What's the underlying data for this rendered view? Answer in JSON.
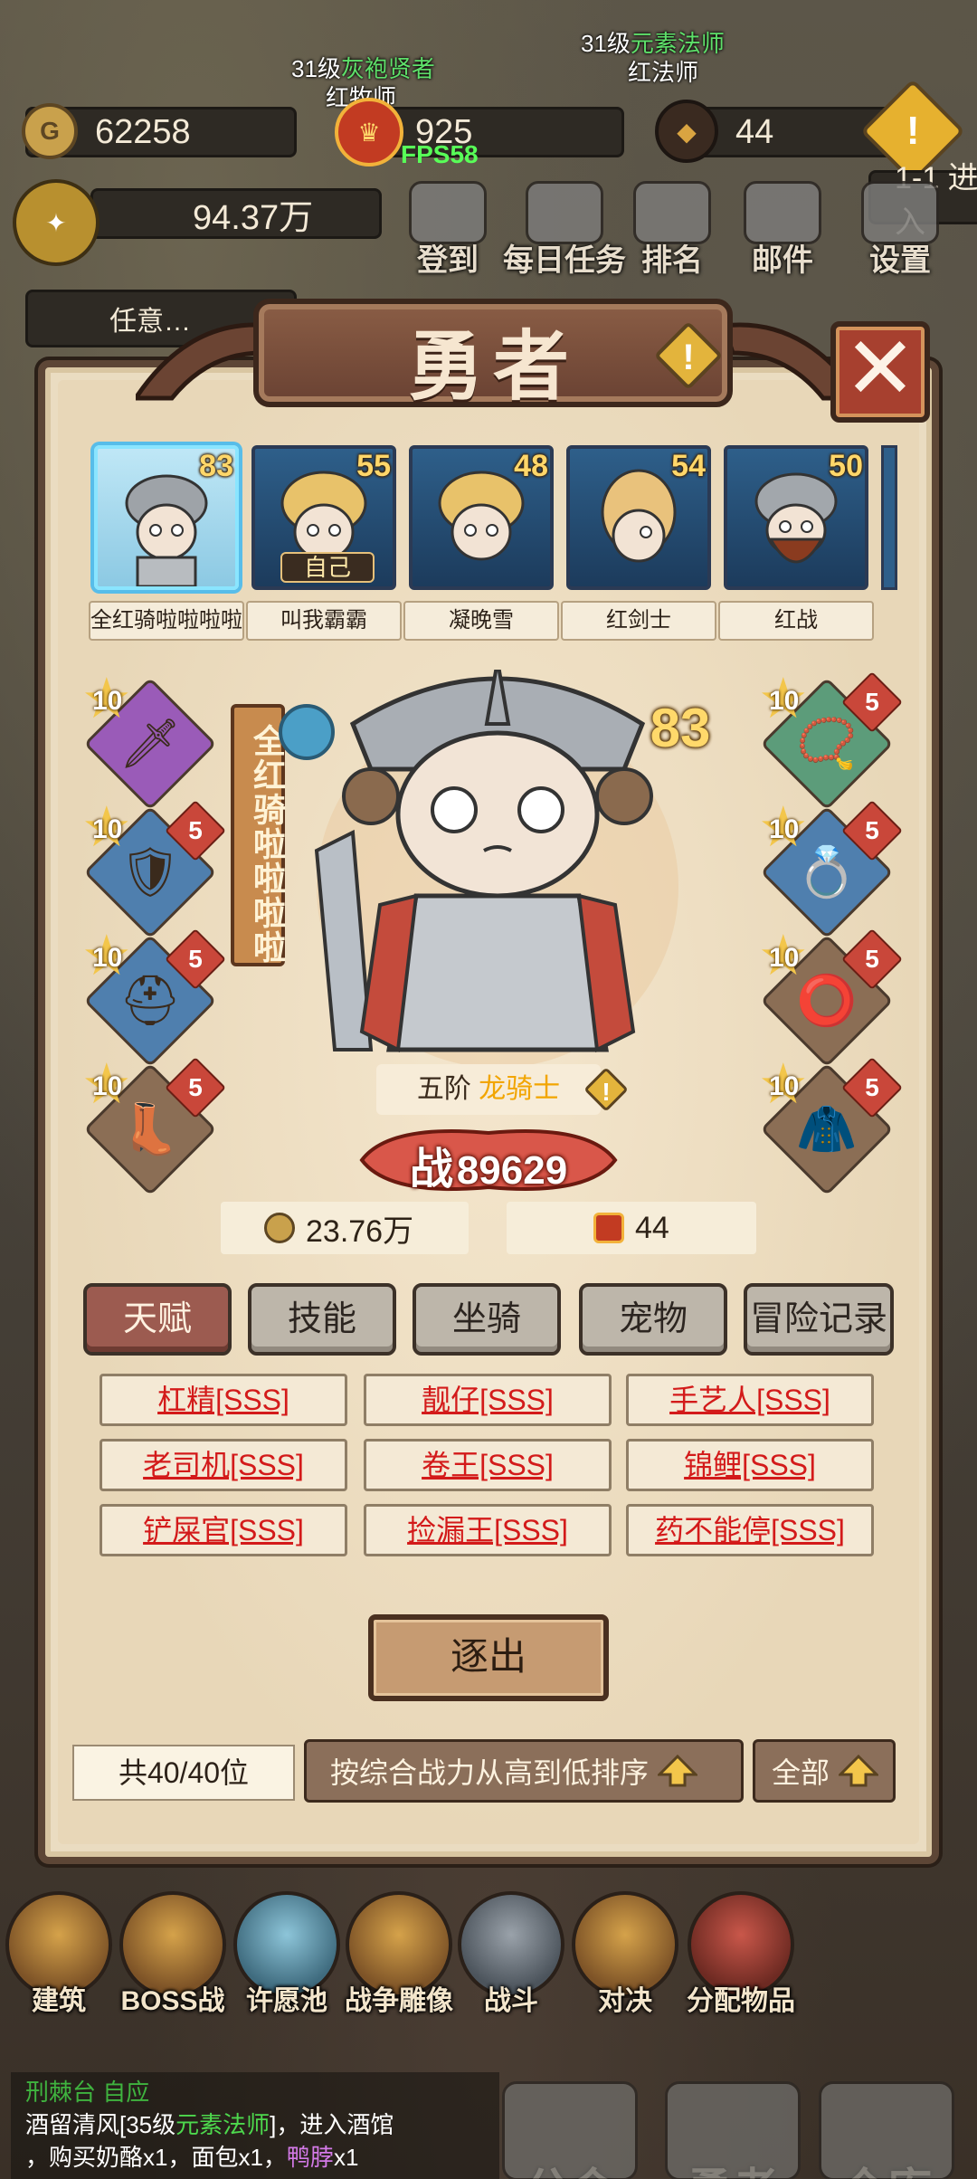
{
  "background_labels": [
    {
      "prefix": "31级",
      "highlight": "灰袍贤者",
      "suffix": ""
    },
    {
      "prefix": "",
      "highlight": "",
      "suffix": "红牧师"
    },
    {
      "prefix": "31级",
      "highlight": "元素法师",
      "suffix": ""
    },
    {
      "prefix": "",
      "highlight": "",
      "suffix": "红法师"
    }
  ],
  "resources": {
    "gold": "62258",
    "crest": "925",
    "bag": "44",
    "power": "94.37万",
    "fps": "FPS58",
    "quest_text": "任意…",
    "progress_text": "1-1 进入"
  },
  "top_menu": [
    "登到",
    "每日任务",
    "排名",
    "邮件",
    "设置"
  ],
  "panel": {
    "title": "勇者",
    "close_symbol": "✕",
    "info_symbol": "!"
  },
  "heroes": [
    {
      "name": "全红骑啦啦啦啦",
      "level": "83",
      "selected": true,
      "tag": ""
    },
    {
      "name": "叫我霸霸",
      "level": "55",
      "selected": false,
      "tag": "自己"
    },
    {
      "name": "凝晚雪",
      "level": "48",
      "selected": false,
      "tag": ""
    },
    {
      "name": "红剑士",
      "level": "54",
      "selected": false,
      "tag": ""
    },
    {
      "name": "红战",
      "level": "50",
      "selected": false,
      "tag": ""
    }
  ],
  "selected_hero": {
    "vertical_name": "全红骑啦啦啦啦",
    "level": "83",
    "class_prefix": "五阶",
    "class_name": "龙骑士",
    "power_label": "战",
    "power": "89629",
    "gold": "23.76万",
    "crest": "44"
  },
  "equipment_left": [
    {
      "icon": "spear-icon",
      "glyph": "🗡",
      "stars": "10",
      "gem": "",
      "color": "#9a5bb8"
    },
    {
      "icon": "chest-armor-icon",
      "glyph": "🛡",
      "stars": "10",
      "gem": "5",
      "color": "#4f7fae"
    },
    {
      "icon": "helmet-icon",
      "glyph": "⛑",
      "stars": "10",
      "gem": "5",
      "color": "#4f7fae"
    },
    {
      "icon": "boots-icon",
      "glyph": "👢",
      "stars": "10",
      "gem": "5",
      "color": "#8b6e55"
    }
  ],
  "equipment_right": [
    {
      "icon": "necklace-icon",
      "glyph": "📿",
      "stars": "10",
      "gem": "5",
      "color": "#5c9c7a"
    },
    {
      "icon": "bracer-icon",
      "glyph": "💍",
      "stars": "10",
      "gem": "5",
      "color": "#4f7fae"
    },
    {
      "icon": "ring-icon",
      "glyph": "⭕",
      "stars": "10",
      "gem": "5",
      "color": "#8b6e55"
    },
    {
      "icon": "cape-icon",
      "glyph": "🧥",
      "stars": "10",
      "gem": "5",
      "color": "#8b6e55"
    }
  ],
  "tabs": [
    "天赋",
    "技能",
    "坐骑",
    "宠物",
    "冒险记录"
  ],
  "traits": [
    "杠精[SSS]",
    "靓仔[SSS]",
    "手艺人[SSS]",
    "老司机[SSS]",
    "卷王[SSS]",
    "锦鲤[SSS]",
    "铲屎官[SSS]",
    "捡漏王[SSS]",
    "药不能停[SSS]"
  ],
  "expel_label": "逐出",
  "count_label": "共40/40位",
  "sort_label": "按综合战力从高到低排序",
  "filter_label": "全部",
  "game_menu": [
    "建筑",
    "BOSS战",
    "许愿池",
    "战争雕像",
    "战斗",
    "对决",
    "分配物品"
  ],
  "chat": {
    "line1": "刑棘台 自应",
    "line2_prefix": "酒留清风[35级",
    "line2_class": "元素法师",
    "line2_suffix": "]，进入酒馆",
    "line3_prefix": "，购买奶酪x1，面包x1，",
    "line3_item": "鸭脖",
    "line3_suffix": "x1"
  },
  "bottom_nav": [
    "公会",
    "勇者",
    "仓库"
  ]
}
